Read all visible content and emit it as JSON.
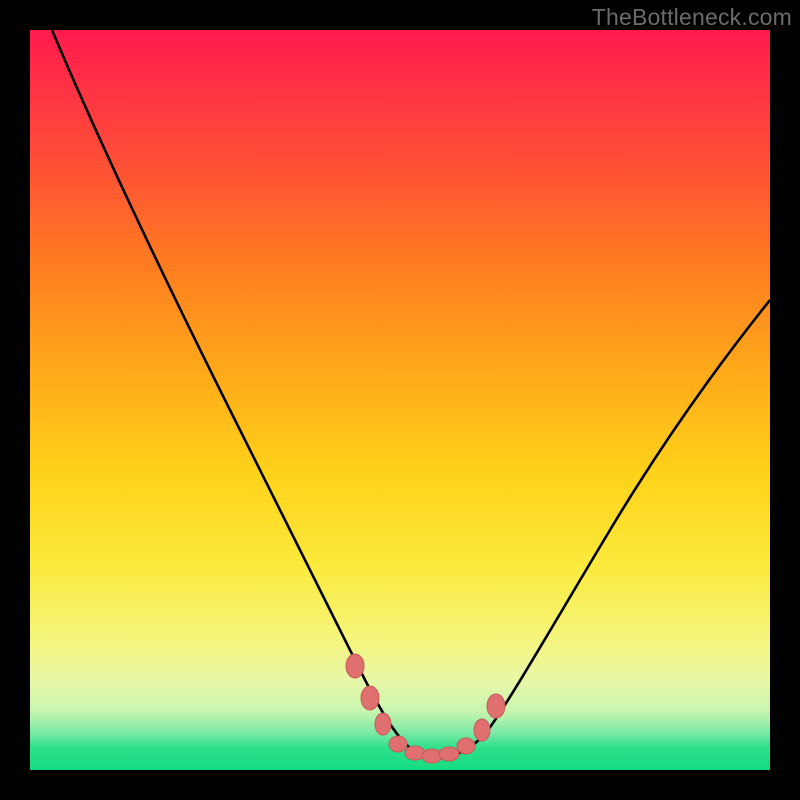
{
  "watermark": "TheBottleneck.com",
  "chart_data": {
    "type": "line",
    "title": "",
    "xlabel": "",
    "ylabel": "",
    "xlim": [
      0,
      100
    ],
    "ylim": [
      0,
      100
    ],
    "series": [
      {
        "name": "bottleneck-curve",
        "x": [
          3,
          10,
          20,
          30,
          38,
          42,
          44,
          46,
          48,
          50,
          52,
          54,
          56,
          58,
          60,
          62,
          66,
          74,
          84,
          94,
          100
        ],
        "values": [
          100,
          84,
          62,
          42,
          26,
          18,
          13,
          9,
          6,
          4,
          3,
          3,
          3,
          4,
          6,
          9,
          15,
          27,
          42,
          56,
          64
        ]
      }
    ],
    "markers": [
      {
        "name": "marker-left-upper",
        "x": 44,
        "y": 13
      },
      {
        "name": "marker-left-mid",
        "x": 46,
        "y": 9
      },
      {
        "name": "marker-left-low",
        "x": 48,
        "y": 6
      },
      {
        "name": "marker-bottom-1",
        "x": 50,
        "y": 4
      },
      {
        "name": "marker-bottom-2",
        "x": 52,
        "y": 3
      },
      {
        "name": "marker-bottom-3",
        "x": 54,
        "y": 3
      },
      {
        "name": "marker-bottom-4",
        "x": 56,
        "y": 3
      },
      {
        "name": "marker-bottom-5",
        "x": 58,
        "y": 4
      },
      {
        "name": "marker-right-low",
        "x": 60,
        "y": 6
      },
      {
        "name": "marker-right-upper",
        "x": 62,
        "y": 9
      }
    ],
    "gradient_stops": [
      {
        "pos": 0,
        "color": "#ff1a4d"
      },
      {
        "pos": 8,
        "color": "#ff3344"
      },
      {
        "pos": 20,
        "color": "#ff5533"
      },
      {
        "pos": 30,
        "color": "#ff7722"
      },
      {
        "pos": 45,
        "color": "#ffa61a"
      },
      {
        "pos": 60,
        "color": "#ffd21a"
      },
      {
        "pos": 72,
        "color": "#fbe93a"
      },
      {
        "pos": 82,
        "color": "#f5f57a"
      },
      {
        "pos": 88,
        "color": "#e8f7a8"
      },
      {
        "pos": 92,
        "color": "#c8f5b0"
      },
      {
        "pos": 95,
        "color": "#7ae9a4"
      },
      {
        "pos": 97,
        "color": "#2de08a"
      },
      {
        "pos": 100,
        "color": "#15dc80"
      }
    ],
    "colors": {
      "curve": "#000000",
      "marker_fill": "#e07070",
      "marker_stroke": "#c85a5a",
      "frame": "#000000"
    }
  }
}
